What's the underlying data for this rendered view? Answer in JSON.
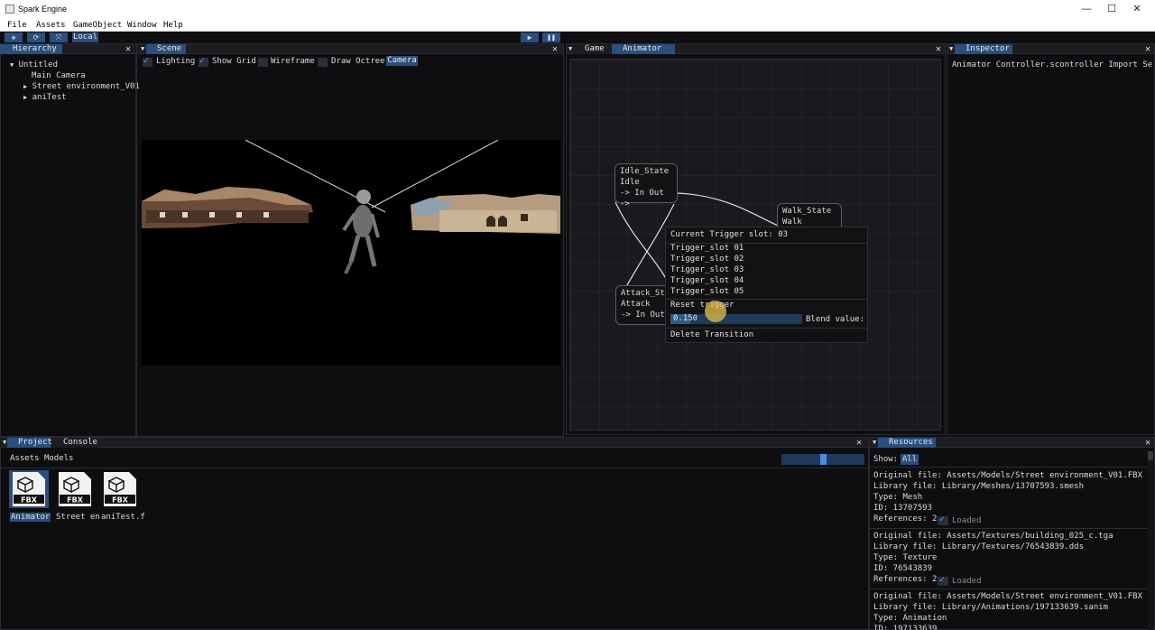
{
  "window": {
    "title": "Spark Engine",
    "controls": [
      "minimize-icon",
      "maximize-icon",
      "close-icon"
    ]
  },
  "menu": [
    "File",
    "Assets",
    "GameObject",
    "Window",
    "Help"
  ],
  "toolbar": {
    "tool_icons": [
      "move-icon",
      "rotate-icon",
      "scale-icon"
    ],
    "space_label": "Local",
    "play_icon": "play-icon",
    "pause_icon": "pause-icon"
  },
  "hierarchy": {
    "tab": "Hierarchy",
    "root": "Untitled",
    "items": [
      "Main Camera",
      "Street environment_V01",
      "aniTest"
    ]
  },
  "scene": {
    "tab": "Scene",
    "options": {
      "lighting": "Lighting",
      "show_grid": "Show Grid",
      "wireframe": "Wireframe",
      "draw_octree": "Draw Octree",
      "camera": "Camera"
    }
  },
  "animator": {
    "tabs": [
      "Game",
      "Animator"
    ],
    "nodes": {
      "idle": {
        "name": "Idle_State",
        "clip": "Idle",
        "ports": "-> In Out ->"
      },
      "walk": {
        "name": "Walk_State",
        "clip": "Walk"
      },
      "attack": {
        "name": "Attack_State",
        "clip": "Attack",
        "ports": "-> In Out"
      }
    },
    "context_menu": {
      "header": "Current Trigger slot: 03",
      "slots": [
        "Trigger_slot 01",
        "Trigger_slot 02",
        "Trigger_slot 03",
        "Trigger_slot 04",
        "Trigger_slot 05"
      ],
      "reset": "Reset trigger",
      "blend_value": "0.150",
      "blend_fraction": 0.15,
      "blend_label": "Blend value:",
      "delete": "Delete Transition"
    }
  },
  "inspector": {
    "tab": "Inspector",
    "line": "Animator Controller.scontroller Import Settin"
  },
  "project": {
    "tabs": [
      "Project",
      "Console"
    ],
    "breadcrumb": [
      "Assets",
      "Models"
    ],
    "slider_fraction": 0.5,
    "assets": [
      {
        "label": "Animator",
        "badge": "FBX",
        "selected": true
      },
      {
        "label": "Street en",
        "badge": "FBX",
        "selected": false
      },
      {
        "label": "aniTest.f",
        "badge": "FBX",
        "selected": false
      }
    ]
  },
  "resources": {
    "tab": "Resources",
    "show_label": "Show:",
    "filter": "All",
    "loaded_label": "Loaded",
    "entries": [
      {
        "original": "Original file: Assets/Models/Street environment_V01.FBX",
        "library": "Library file: Library/Meshes/13707593.smesh",
        "type": "Type: Mesh",
        "id": "ID: 13707593",
        "refs": "References: 2"
      },
      {
        "original": "Original file: Assets/Textures/building_025_c.tga",
        "library": "Library file: Library/Textures/76543839.dds",
        "type": "Type: Texture",
        "id": "ID: 76543839",
        "refs": "References: 2"
      },
      {
        "original": "Original file: Assets/Models/Street environment_V01.FBX",
        "library": "Library file: Library/Animations/197133639.sanim",
        "type": "Type: Animation",
        "id": "ID: 197133639"
      }
    ]
  },
  "colors": {
    "accent": "#2a4f7e",
    "background": "#0e0e10",
    "panel_header": "#1d1d21",
    "cursor_highlight": "#e6c34a"
  }
}
